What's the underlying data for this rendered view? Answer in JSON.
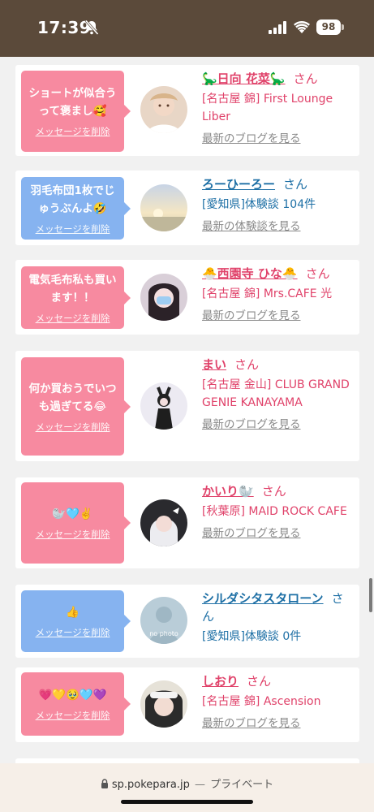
{
  "status_bar": {
    "time": "17:39",
    "battery": "98"
  },
  "cards": [
    {
      "bubble_color": "pink",
      "message": "ショートが似合うって褒まし🥰",
      "delete_label": "メッセージを削除",
      "name": "🦕日向 花菜🦕",
      "name_color": "pink",
      "honorific": "さん",
      "shop": "[名古屋 錦] First Lounge Liber",
      "link": "最新のブログを見る"
    },
    {
      "bubble_color": "blue",
      "message": "羽毛布団1枚でじゅうぶんよ🤣",
      "delete_label": "メッセージを削除",
      "name": "ろーひーろー",
      "name_color": "blue",
      "honorific": "さん",
      "shop": "[愛知県]体験談 104件",
      "link": "最新の体験談を見る"
    },
    {
      "bubble_color": "pink",
      "message": "電気毛布私も買います！！",
      "delete_label": "メッセージを削除",
      "name": "🐣西園寺 ひな🐣",
      "name_color": "pink",
      "honorific": "さん",
      "shop": "[名古屋 錦] Mrs.CAFE 光",
      "link": "最新のブログを見る"
    },
    {
      "bubble_color": "pink",
      "message": "何か買おうでいつも過ぎてる😂",
      "delete_label": "メッセージを削除",
      "name": "まい",
      "name_color": "pink",
      "honorific": "さん",
      "shop": "[名古屋 金山] CLUB GRAND GENIE KANAYAMA",
      "link": "最新のブログを見る"
    },
    {
      "bubble_color": "pink",
      "message": "🦭🩵✌️",
      "delete_label": "メッセージを削除",
      "name": "かいり🦭",
      "name_color": "pink",
      "honorific": "さん",
      "shop": "[秋葉原] MAID ROCK CAFE",
      "link": "最新のブログを見る"
    },
    {
      "bubble_color": "blue",
      "message": "👍",
      "delete_label": "メッセージを削除",
      "name": "シルダシタスタローン",
      "name_color": "blue",
      "honorific": "さん",
      "shop": "[愛知県]体験談 0件",
      "link": "",
      "avatar_text": "no photo"
    },
    {
      "bubble_color": "pink",
      "message": "💗💛🥹🩵💜",
      "delete_label": "メッセージを削除",
      "name": "しおり",
      "name_color": "pink",
      "honorific": "さん",
      "shop": "[名古屋 錦] Ascension",
      "link": "最新のブログを見る"
    }
  ],
  "browser": {
    "domain": "sp.pokepara.jp",
    "separator": "—",
    "mode": "プライベート"
  }
}
